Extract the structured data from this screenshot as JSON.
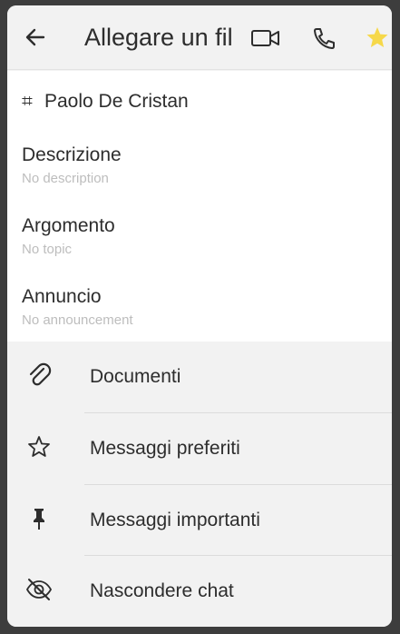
{
  "header": {
    "title": "Allegare un fil",
    "icons": [
      "back-arrow-icon",
      "video-camera-icon",
      "phone-icon",
      "star-icon"
    ],
    "star_color": "#f6d84a"
  },
  "room": {
    "name": "Paolo De Cristan",
    "hash_symbol": "⌗"
  },
  "fields": {
    "description": {
      "label": "Descrizione",
      "value": "No description"
    },
    "topic": {
      "label": "Argomento",
      "value": "No topic"
    },
    "announcement": {
      "label": "Annuncio",
      "value": "No announcement"
    }
  },
  "menu": {
    "items": [
      {
        "label": "Documenti",
        "icon": "paperclip-icon"
      },
      {
        "label": "Messaggi preferiti",
        "icon": "star-outline-icon"
      },
      {
        "label": "Messaggi importanti",
        "icon": "pin-icon"
      },
      {
        "label": "Nascondere chat",
        "icon": "eye-off-icon"
      }
    ]
  }
}
